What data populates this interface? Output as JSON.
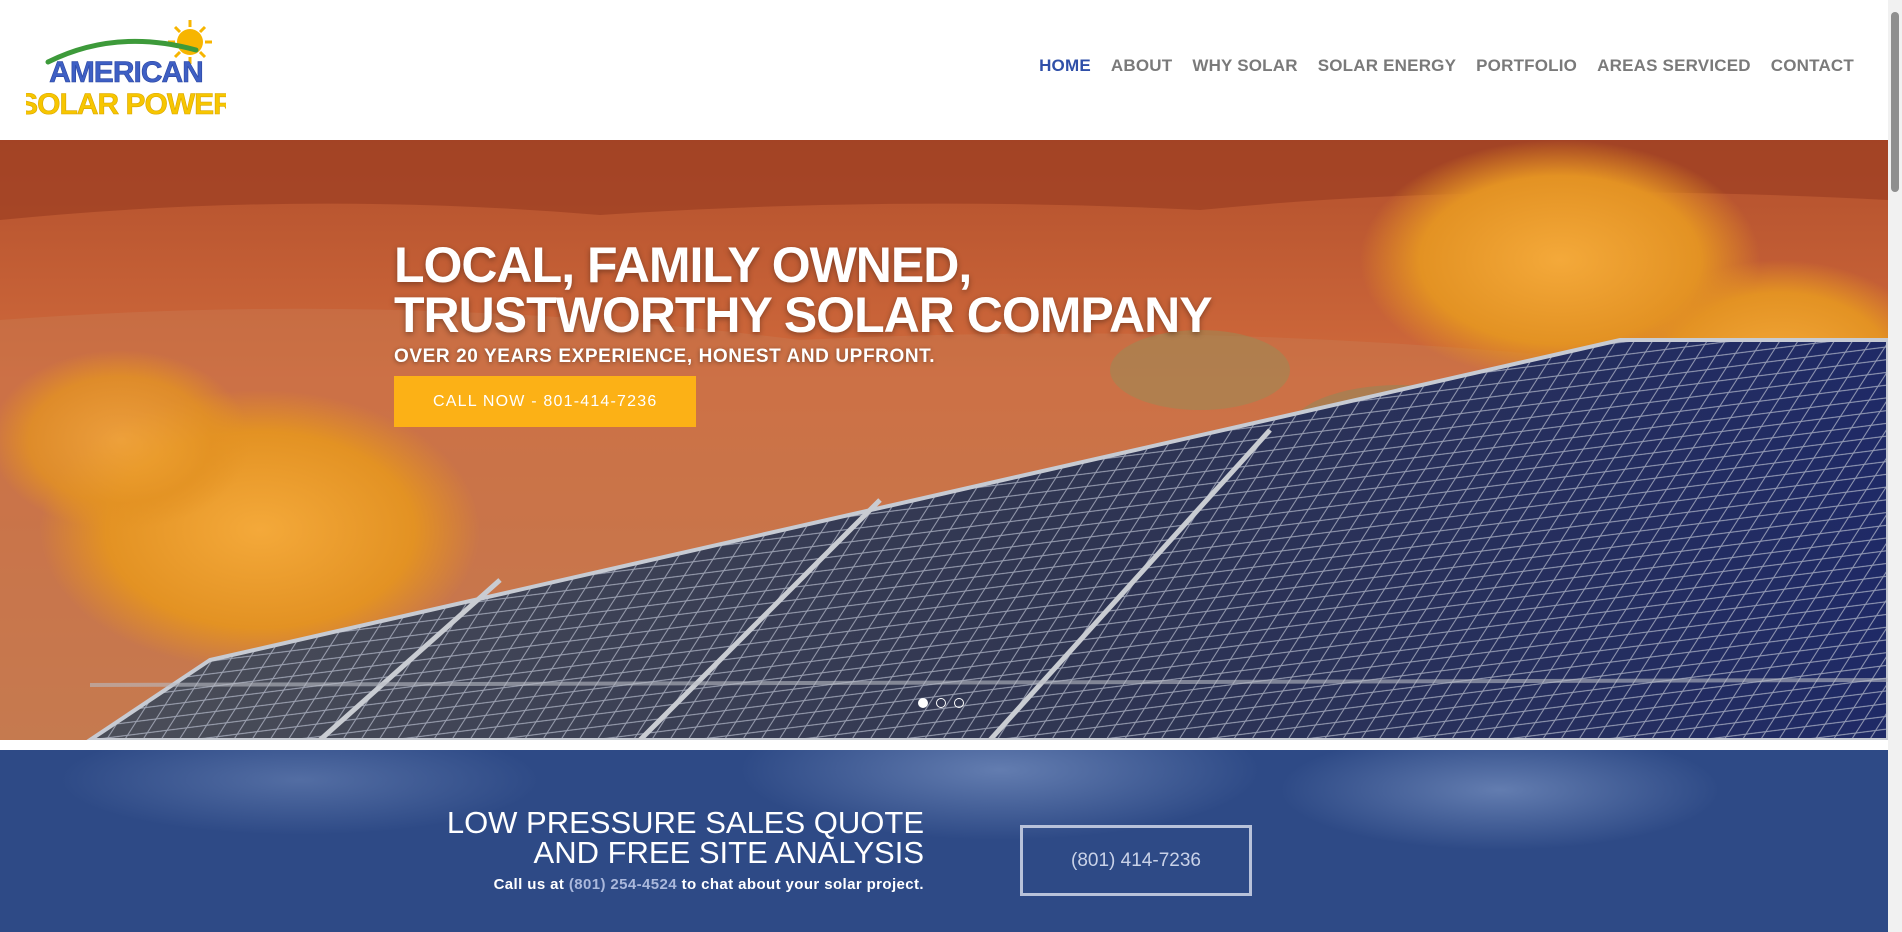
{
  "brand": {
    "logo_line1": "AMERICAN",
    "logo_line2": "SOLAR POWER",
    "colors": {
      "blue": "#3e5fc4",
      "yellow": "#f7c600",
      "green": "#3d9a3a"
    }
  },
  "nav": {
    "items": [
      {
        "label": "HOME",
        "active": true
      },
      {
        "label": "ABOUT",
        "active": false
      },
      {
        "label": "WHY SOLAR",
        "active": false
      },
      {
        "label": "SOLAR ENERGY",
        "active": false
      },
      {
        "label": "PORTFOLIO",
        "active": false
      },
      {
        "label": "AREAS SERVICED",
        "active": false
      },
      {
        "label": "CONTACT",
        "active": false
      }
    ],
    "active_color": "#2f4fa8",
    "color": "#7a7a7a"
  },
  "hero": {
    "title_line1": "LOCAL, FAMILY OWNED,",
    "title_line2": "TRUSTWORTHY SOLAR COMPANY",
    "subtitle": "OVER 20 YEARS EXPERIENCE, HONEST AND UPFRONT.",
    "cta_label": "CALL NOW - 801-414-7236",
    "cta_color": "#fcb116",
    "slider": {
      "slide_count": 3,
      "active_slide": 1
    }
  },
  "banner": {
    "title_line1": "LOW PRESSURE SALES QUOTE",
    "title_line2": "AND FREE SITE ANALYSIS",
    "sub_prefix": "Call us at ",
    "sub_phone": "(801) 254-4524",
    "sub_suffix": " to chat about your solar project.",
    "button_label": "(801) 414-7236"
  }
}
